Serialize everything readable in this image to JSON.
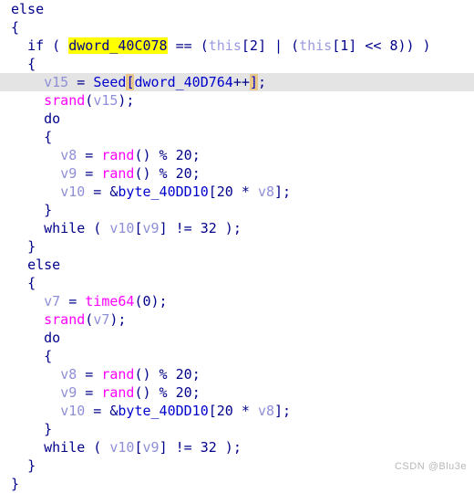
{
  "editor": {
    "name": "hex-rays-pseudocode-view",
    "background_color": "#ffffff",
    "current_line_color": "#e4e4e4",
    "find_highlight_color": "#ffff00",
    "bracket_highlight_color": "#e8c88a",
    "colors": {
      "keyword": "#00008b",
      "global": "#0000cd",
      "local_variable": "#8f8fd8",
      "this_keyword": "#9a9ade",
      "function": "#ff00ff",
      "number": "#00008b",
      "punctuation": "#00008b"
    }
  },
  "lines": [
    {
      "n": 1,
      "indent": "",
      "current": false,
      "tokens": [
        {
          "t": "kw",
          "v": "else"
        }
      ]
    },
    {
      "n": 2,
      "indent": "",
      "current": false,
      "tokens": [
        {
          "t": "punc",
          "v": "{"
        }
      ]
    },
    {
      "n": 3,
      "indent": "  ",
      "current": false,
      "tokens": [
        {
          "t": "kw",
          "v": "if"
        },
        {
          "t": "punc",
          "v": " ( "
        },
        {
          "t": "glob",
          "v": "dword_40C078",
          "hl": "find"
        },
        {
          "t": "op",
          "v": " == "
        },
        {
          "t": "punc",
          "v": "("
        },
        {
          "t": "this",
          "v": "this"
        },
        {
          "t": "punc",
          "v": "["
        },
        {
          "t": "num",
          "v": "2"
        },
        {
          "t": "punc",
          "v": "]"
        },
        {
          "t": "op",
          "v": " | "
        },
        {
          "t": "punc",
          "v": "("
        },
        {
          "t": "this",
          "v": "this"
        },
        {
          "t": "punc",
          "v": "["
        },
        {
          "t": "num",
          "v": "1"
        },
        {
          "t": "punc",
          "v": "]"
        },
        {
          "t": "op",
          "v": " << "
        },
        {
          "t": "num",
          "v": "8"
        },
        {
          "t": "punc",
          "v": ")) )"
        }
      ]
    },
    {
      "n": 4,
      "indent": "  ",
      "current": false,
      "tokens": [
        {
          "t": "punc",
          "v": "{"
        }
      ]
    },
    {
      "n": 5,
      "indent": "    ",
      "current": true,
      "tokens": [
        {
          "t": "var",
          "v": "v15"
        },
        {
          "t": "op",
          "v": " = "
        },
        {
          "t": "glob",
          "v": "Seed"
        },
        {
          "t": "punc",
          "v": "[",
          "hl": "brack"
        },
        {
          "t": "glob",
          "v": "dword_40D764"
        },
        {
          "t": "op",
          "v": "++"
        },
        {
          "t": "punc",
          "v": "]",
          "hl": "brack"
        },
        {
          "t": "punc",
          "v": ";"
        }
      ]
    },
    {
      "n": 6,
      "indent": "    ",
      "current": false,
      "tokens": [
        {
          "t": "func",
          "v": "srand"
        },
        {
          "t": "punc",
          "v": "("
        },
        {
          "t": "var",
          "v": "v15"
        },
        {
          "t": "punc",
          "v": ");"
        }
      ]
    },
    {
      "n": 7,
      "indent": "    ",
      "current": false,
      "tokens": [
        {
          "t": "kw",
          "v": "do"
        }
      ]
    },
    {
      "n": 8,
      "indent": "    ",
      "current": false,
      "tokens": [
        {
          "t": "punc",
          "v": "{"
        }
      ]
    },
    {
      "n": 9,
      "indent": "      ",
      "current": false,
      "tokens": [
        {
          "t": "var",
          "v": "v8"
        },
        {
          "t": "op",
          "v": " = "
        },
        {
          "t": "func",
          "v": "rand"
        },
        {
          "t": "punc",
          "v": "()"
        },
        {
          "t": "op",
          "v": " % "
        },
        {
          "t": "num",
          "v": "20"
        },
        {
          "t": "punc",
          "v": ";"
        }
      ]
    },
    {
      "n": 10,
      "indent": "      ",
      "current": false,
      "tokens": [
        {
          "t": "var",
          "v": "v9"
        },
        {
          "t": "op",
          "v": " = "
        },
        {
          "t": "func",
          "v": "rand"
        },
        {
          "t": "punc",
          "v": "()"
        },
        {
          "t": "op",
          "v": " % "
        },
        {
          "t": "num",
          "v": "20"
        },
        {
          "t": "punc",
          "v": ";"
        }
      ]
    },
    {
      "n": 11,
      "indent": "      ",
      "current": false,
      "tokens": [
        {
          "t": "var",
          "v": "v10"
        },
        {
          "t": "op",
          "v": " = "
        },
        {
          "t": "op",
          "v": "&"
        },
        {
          "t": "glob",
          "v": "byte_40DD10"
        },
        {
          "t": "punc",
          "v": "["
        },
        {
          "t": "num",
          "v": "20"
        },
        {
          "t": "op",
          "v": " * "
        },
        {
          "t": "var",
          "v": "v8"
        },
        {
          "t": "punc",
          "v": "];"
        }
      ]
    },
    {
      "n": 12,
      "indent": "    ",
      "current": false,
      "tokens": [
        {
          "t": "punc",
          "v": "}"
        }
      ]
    },
    {
      "n": 13,
      "indent": "    ",
      "current": false,
      "tokens": [
        {
          "t": "kw",
          "v": "while"
        },
        {
          "t": "punc",
          "v": " ( "
        },
        {
          "t": "var",
          "v": "v10"
        },
        {
          "t": "punc",
          "v": "["
        },
        {
          "t": "var",
          "v": "v9"
        },
        {
          "t": "punc",
          "v": "]"
        },
        {
          "t": "op",
          "v": " != "
        },
        {
          "t": "num",
          "v": "32"
        },
        {
          "t": "punc",
          "v": " );"
        }
      ]
    },
    {
      "n": 14,
      "indent": "  ",
      "current": false,
      "tokens": [
        {
          "t": "punc",
          "v": "}"
        }
      ]
    },
    {
      "n": 15,
      "indent": "  ",
      "current": false,
      "tokens": [
        {
          "t": "kw",
          "v": "else"
        }
      ]
    },
    {
      "n": 16,
      "indent": "  ",
      "current": false,
      "tokens": [
        {
          "t": "punc",
          "v": "{"
        }
      ]
    },
    {
      "n": 17,
      "indent": "    ",
      "current": false,
      "tokens": [
        {
          "t": "var",
          "v": "v7"
        },
        {
          "t": "op",
          "v": " = "
        },
        {
          "t": "func",
          "v": "time64"
        },
        {
          "t": "punc",
          "v": "("
        },
        {
          "t": "num",
          "v": "0"
        },
        {
          "t": "punc",
          "v": ");"
        }
      ]
    },
    {
      "n": 18,
      "indent": "    ",
      "current": false,
      "tokens": [
        {
          "t": "func",
          "v": "srand"
        },
        {
          "t": "punc",
          "v": "("
        },
        {
          "t": "var",
          "v": "v7"
        },
        {
          "t": "punc",
          "v": ");"
        }
      ]
    },
    {
      "n": 19,
      "indent": "    ",
      "current": false,
      "tokens": [
        {
          "t": "kw",
          "v": "do"
        }
      ]
    },
    {
      "n": 20,
      "indent": "    ",
      "current": false,
      "tokens": [
        {
          "t": "punc",
          "v": "{"
        }
      ]
    },
    {
      "n": 21,
      "indent": "      ",
      "current": false,
      "tokens": [
        {
          "t": "var",
          "v": "v8"
        },
        {
          "t": "op",
          "v": " = "
        },
        {
          "t": "func",
          "v": "rand"
        },
        {
          "t": "punc",
          "v": "()"
        },
        {
          "t": "op",
          "v": " % "
        },
        {
          "t": "num",
          "v": "20"
        },
        {
          "t": "punc",
          "v": ";"
        }
      ]
    },
    {
      "n": 22,
      "indent": "      ",
      "current": false,
      "tokens": [
        {
          "t": "var",
          "v": "v9"
        },
        {
          "t": "op",
          "v": " = "
        },
        {
          "t": "func",
          "v": "rand"
        },
        {
          "t": "punc",
          "v": "()"
        },
        {
          "t": "op",
          "v": " % "
        },
        {
          "t": "num",
          "v": "20"
        },
        {
          "t": "punc",
          "v": ";"
        }
      ]
    },
    {
      "n": 23,
      "indent": "      ",
      "current": false,
      "tokens": [
        {
          "t": "var",
          "v": "v10"
        },
        {
          "t": "op",
          "v": " = "
        },
        {
          "t": "op",
          "v": "&"
        },
        {
          "t": "glob",
          "v": "byte_40DD10"
        },
        {
          "t": "punc",
          "v": "["
        },
        {
          "t": "num",
          "v": "20"
        },
        {
          "t": "op",
          "v": " * "
        },
        {
          "t": "var",
          "v": "v8"
        },
        {
          "t": "punc",
          "v": "];"
        }
      ]
    },
    {
      "n": 24,
      "indent": "    ",
      "current": false,
      "tokens": [
        {
          "t": "punc",
          "v": "}"
        }
      ]
    },
    {
      "n": 25,
      "indent": "    ",
      "current": false,
      "tokens": [
        {
          "t": "kw",
          "v": "while"
        },
        {
          "t": "punc",
          "v": " ( "
        },
        {
          "t": "var",
          "v": "v10"
        },
        {
          "t": "punc",
          "v": "["
        },
        {
          "t": "var",
          "v": "v9"
        },
        {
          "t": "punc",
          "v": "]"
        },
        {
          "t": "op",
          "v": " != "
        },
        {
          "t": "num",
          "v": "32"
        },
        {
          "t": "punc",
          "v": " );"
        }
      ]
    },
    {
      "n": 26,
      "indent": "  ",
      "current": false,
      "tokens": [
        {
          "t": "punc",
          "v": "}"
        }
      ]
    },
    {
      "n": 27,
      "indent": "",
      "current": false,
      "tokens": [
        {
          "t": "punc",
          "v": "}"
        }
      ]
    }
  ],
  "watermark": {
    "text": "CSDN @Blu3e"
  }
}
